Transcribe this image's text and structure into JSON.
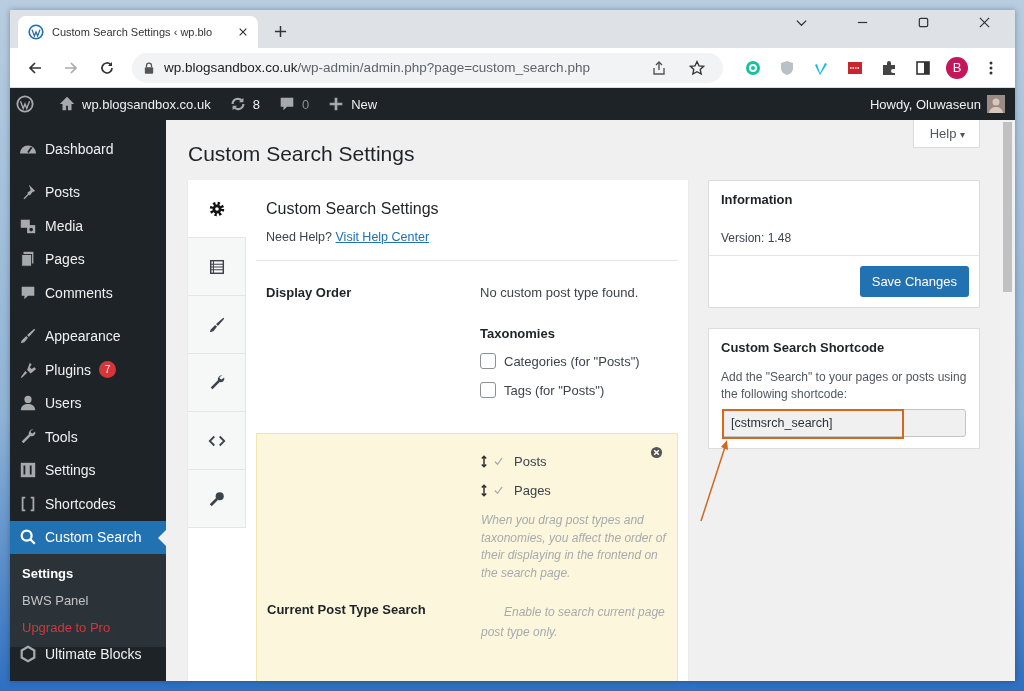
{
  "browser": {
    "tab_title": "Custom Search Settings ‹ wp.blo",
    "url_host": "wp.blogsandbox.co.uk",
    "url_path": "/wp-admin/admin.php?page=custom_search.php",
    "profile": "B"
  },
  "admin_bar": {
    "site": "wp.blogsandbox.co.uk",
    "updates": "8",
    "comments": "0",
    "new": "New",
    "greeting": "Howdy, Oluwaseun"
  },
  "sidebar": {
    "groups": [
      [
        {
          "label": "Dashboard",
          "selected": false
        }
      ],
      [
        {
          "label": "Posts",
          "selected": false
        },
        {
          "label": "Media",
          "selected": false
        },
        {
          "label": "Pages",
          "selected": false
        },
        {
          "label": "Comments",
          "selected": false
        }
      ],
      [
        {
          "label": "Appearance",
          "selected": false
        },
        {
          "label": "Plugins",
          "selected": false,
          "badge": "7"
        },
        {
          "label": "Users",
          "selected": false
        },
        {
          "label": "Tools",
          "selected": false
        },
        {
          "label": "Settings",
          "selected": false
        },
        {
          "label": "Shortcodes",
          "selected": false
        },
        {
          "label": "Custom Search",
          "selected": true,
          "children": [
            {
              "label": "Settings",
              "selected": true,
              "kind": "link"
            },
            {
              "label": "BWS Panel",
              "selected": false,
              "kind": "link"
            },
            {
              "label": "Upgrade to Pro",
              "selected": false,
              "kind": "upgrade"
            }
          ]
        },
        {
          "label": "Ultimate Blocks",
          "selected": false
        }
      ]
    ]
  },
  "page": {
    "title": "Custom Search Settings",
    "help": "Help",
    "help_caret": "▾"
  },
  "settings": {
    "tabs": [
      {
        "selected": true
      },
      {
        "selected": false
      },
      {
        "selected": false
      },
      {
        "selected": false
      },
      {
        "selected": false
      },
      {
        "selected": false
      }
    ],
    "heading": "Custom Search Settings",
    "help_prefix": "Need Help?",
    "help_link": "Visit Help Center",
    "display_order": {
      "label": "Display Order",
      "message": "No custom post type found.",
      "taxonomies_heading": "Taxonomies",
      "checkboxes": [
        {
          "label": "Categories (for \"Posts\")",
          "checked": false
        },
        {
          "label": "Tags (for \"Posts\")",
          "checked": false
        }
      ]
    },
    "sortable": {
      "items": [
        {
          "label": "Posts",
          "checked": true
        },
        {
          "label": "Pages",
          "checked": true
        }
      ],
      "note": "When you drag post types and taxonomies, you affect the order of their displaying in the frontend on the search page."
    },
    "current_post_type": {
      "label": "Current Post Type Search",
      "note": "Enable to search current page post type only."
    }
  },
  "information": {
    "title": "Information",
    "version": "Version: 1.48",
    "save": "Save Changes"
  },
  "shortcode": {
    "title": "Custom Search Shortcode",
    "description": "Add the \"Search\" to your pages or posts using the following shortcode:",
    "value": "[cstmsrch_search]"
  }
}
